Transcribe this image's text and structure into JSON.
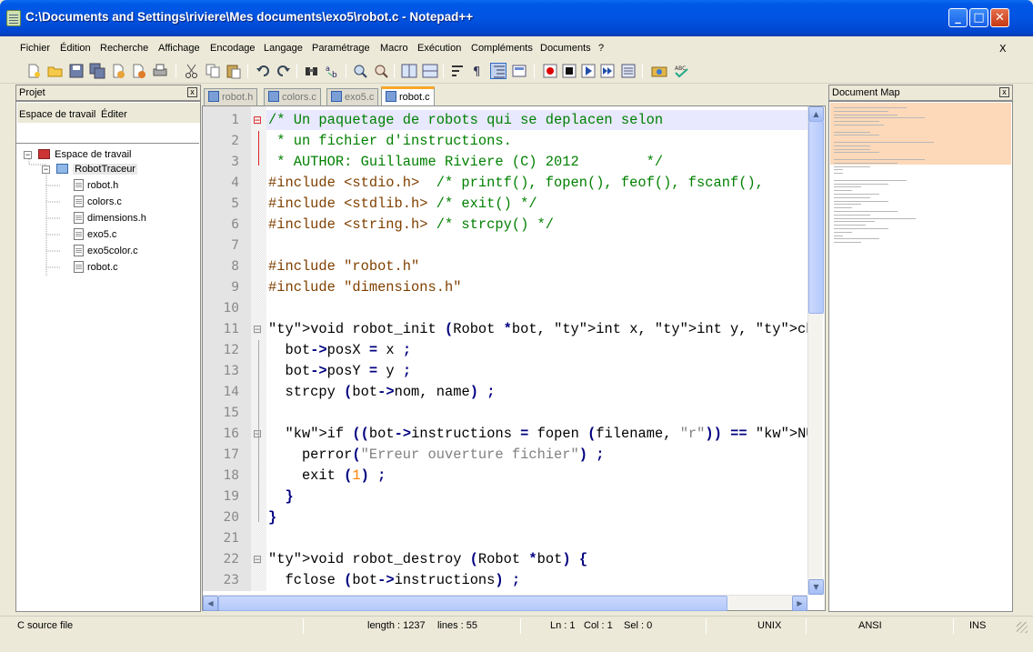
{
  "window": {
    "title": "C:\\Documents and Settings\\riviere\\Mes documents\\exo5\\robot.c - Notepad++",
    "buttons": {
      "minimize": "_",
      "maximize": "□",
      "close": "✕"
    }
  },
  "menu": {
    "items": [
      "Fichier",
      "Édition",
      "Recherche",
      "Affichage",
      "Encodage",
      "Langage",
      "Paramétrage",
      "Macro",
      "Exécution",
      "Compléments",
      "Documents",
      "?"
    ],
    "close_doc": "X"
  },
  "toolbar": {
    "icons": [
      "new-file-icon",
      "open-icon",
      "save-icon",
      "save-all-icon",
      "close-icon",
      "close-all-icon",
      "print-icon",
      "cut-icon",
      "copy-icon",
      "paste-icon",
      "undo-icon",
      "redo-icon",
      "find-icon",
      "replace-icon",
      "zoom-in-icon",
      "zoom-out-icon",
      "sync-v-icon",
      "sync-h-icon",
      "wrap-icon",
      "show-all-chars-icon",
      "indent-guide-icon",
      "user-lang-icon",
      "record-macro-icon",
      "stop-macro-icon",
      "play-macro-icon",
      "run-macro-multiple-icon",
      "save-macro-icon",
      "launch-browser-icon",
      "spellcheck-icon"
    ]
  },
  "project_panel": {
    "title": "Projet",
    "close": "x",
    "menu": {
      "workspace": "Espace de travail",
      "edit": "Éditer"
    },
    "tree": {
      "workspace": "Espace de travail",
      "project": "RobotTraceur",
      "files": [
        "robot.h",
        "colors.c",
        "dimensions.h",
        "exo5.c",
        "exo5color.c",
        "robot.c"
      ]
    }
  },
  "tabs": [
    {
      "label": "robot.h",
      "active": false
    },
    {
      "label": "colors.c",
      "active": false
    },
    {
      "label": "exo5.c",
      "active": false
    },
    {
      "label": "robot.c",
      "active": true
    }
  ],
  "editor": {
    "line_numbers": [
      "1",
      "2",
      "3",
      "4",
      "5",
      "6",
      "7",
      "8",
      "9",
      "10",
      "11",
      "12",
      "13",
      "14",
      "15",
      "16",
      "17",
      "18",
      "19",
      "20",
      "21",
      "22",
      "23"
    ],
    "lines": [
      "/* Un paquetage de robots qui se deplacen selon",
      " * un fichier d'instructions.",
      " * AUTHOR: Guillaume Riviere (C) 2012        */",
      "#include <stdio.h>  /* printf(), fopen(), feof(), fscanf(),",
      "#include <stdlib.h> /* exit() */",
      "#include <string.h> /* strcpy() */",
      "",
      "#include \"robot.h\"",
      "#include \"dimensions.h\"",
      "",
      "void robot_init (Robot *bot, int x, int y, char *name, char",
      "  bot->posX = x ;",
      "  bot->posY = y ;",
      "  strcpy (bot->nom, name) ;",
      "",
      "  if ((bot->instructions = fopen (filename, \"r\")) == NULL)",
      "    perror(\"Erreur ouverture fichier\") ;",
      "    exit (1) ;",
      "  }",
      "}",
      "",
      "void robot_destroy (Robot *bot) {",
      "  fclose (bot->instructions) ;"
    ],
    "tokens": {
      "include": "#include",
      "void": "void",
      "robot_init": " robot_init (Robot ",
      "int": "int",
      "char": "char",
      "if": "if",
      "null": "NULL",
      "one": "1",
      "r": "\"r\"",
      "err": "\"Erreur ouverture fichier\""
    }
  },
  "docmap_panel": {
    "title": "Document Map",
    "close": "x"
  },
  "status": {
    "filetype": "C source file",
    "length": "length : 1237",
    "lines": "lines : 55",
    "ln": "Ln : 1",
    "col": "Col : 1",
    "sel": "Sel : 0",
    "eol": "UNIX",
    "encoding": "ANSI",
    "mode": "INS"
  }
}
